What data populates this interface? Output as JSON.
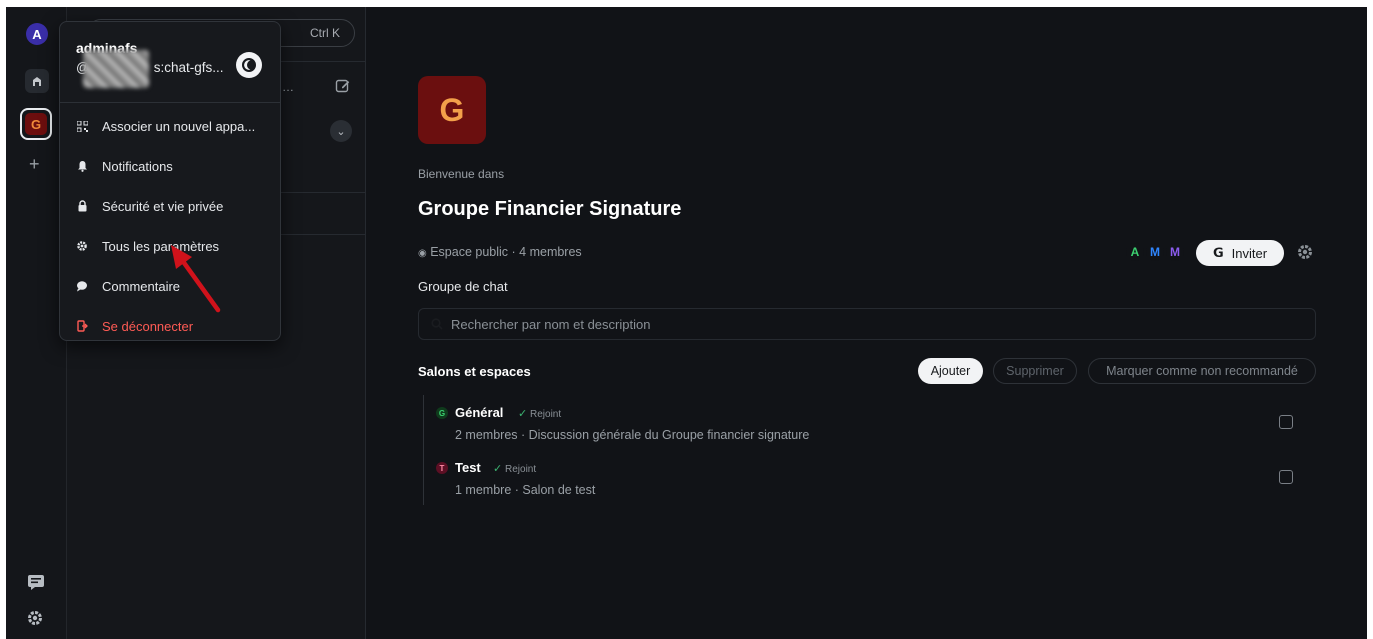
{
  "rail": {
    "user_initial": "A",
    "home_icon": "home-icon",
    "space_initial": "G",
    "add_symbol": "+"
  },
  "roomlist": {
    "search_shortcut": "Ctrl K",
    "more_symbol": "…",
    "chevron": "⌄"
  },
  "menu": {
    "username": "adminafs",
    "user_id_prefix": "@",
    "user_id_suffix": "s:chat-gfs...",
    "items": [
      {
        "label": "Associer un nouvel appa...",
        "icon": "qr-code-icon"
      },
      {
        "label": "Notifications",
        "icon": "bell-icon"
      },
      {
        "label": "Sécurité et vie privée",
        "icon": "lock-icon"
      },
      {
        "label": "Tous les paramètres",
        "icon": "gear-icon"
      },
      {
        "label": "Commentaire",
        "icon": "chat-bubble-icon"
      },
      {
        "label": "Se déconnecter",
        "icon": "sign-out-icon"
      }
    ]
  },
  "space": {
    "initial": "G",
    "welcome": "Bienvenue dans",
    "name": "Groupe Financier Signature",
    "meta": "Espace public · 4 membres",
    "member_initials": [
      "A",
      "M",
      "M"
    ],
    "invite_label": "Inviter",
    "group_label": "Groupe de chat",
    "search_placeholder": "Rechercher par nom et description",
    "rooms_title": "Salons et espaces",
    "add_label": "Ajouter",
    "delete_label": "Supprimer",
    "mark_label": "Marquer comme non recommandé"
  },
  "rooms": [
    {
      "initial": "G",
      "name": "Général",
      "status": "Rejoint",
      "desc": "2 membres · Discussion générale du Groupe financier signature",
      "color": "#1e8e3e"
    },
    {
      "initial": "T",
      "name": "Test",
      "status": "Rejoint",
      "desc": "1 membre · Salon de test",
      "color": "#b0123a"
    }
  ],
  "colors": {
    "accent": "#f08a3a",
    "danger": "#ff5b55",
    "annotation_arrow": "#d0121b"
  }
}
